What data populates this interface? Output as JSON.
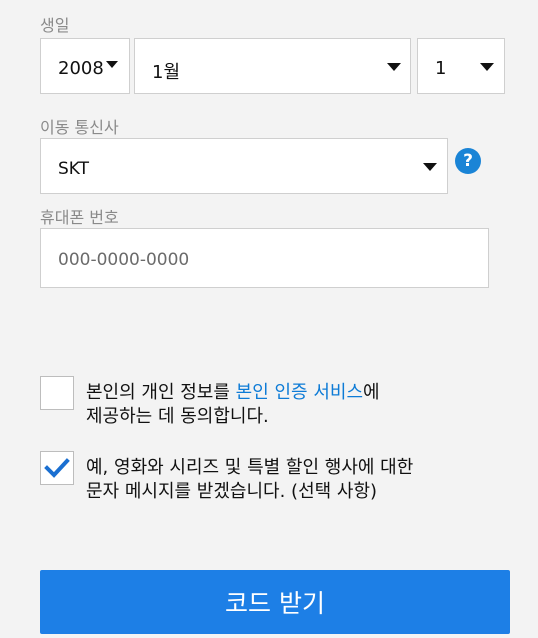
{
  "birthdate": {
    "label": "생일",
    "year": "2008",
    "month": "1월",
    "day": "1"
  },
  "carrier": {
    "label": "이동 통신사",
    "value": "SKT",
    "help_icon": "question-circle-icon",
    "help_glyph": "?"
  },
  "phone": {
    "label": "휴대폰 번호",
    "placeholder": "000-0000-0000"
  },
  "consent_identity": {
    "checked": false,
    "text_before": "본인의 개인 정보를 ",
    "link": "본인 인증 서비스",
    "text_after": "에",
    "line2": "제공하는 데 동의합니다."
  },
  "consent_marketing": {
    "checked": true,
    "line1": "예, 영화와 시리즈 및 특별 할인 행사에 대한",
    "line2": "문자 메시지를 받겠습니다. (선택 사항)"
  },
  "submit_label": "코드 받기",
  "colors": {
    "accent": "#1d7fe6",
    "link": "#0d7bd6",
    "check": "#1a6fd1",
    "background": "#f3f3f3"
  }
}
